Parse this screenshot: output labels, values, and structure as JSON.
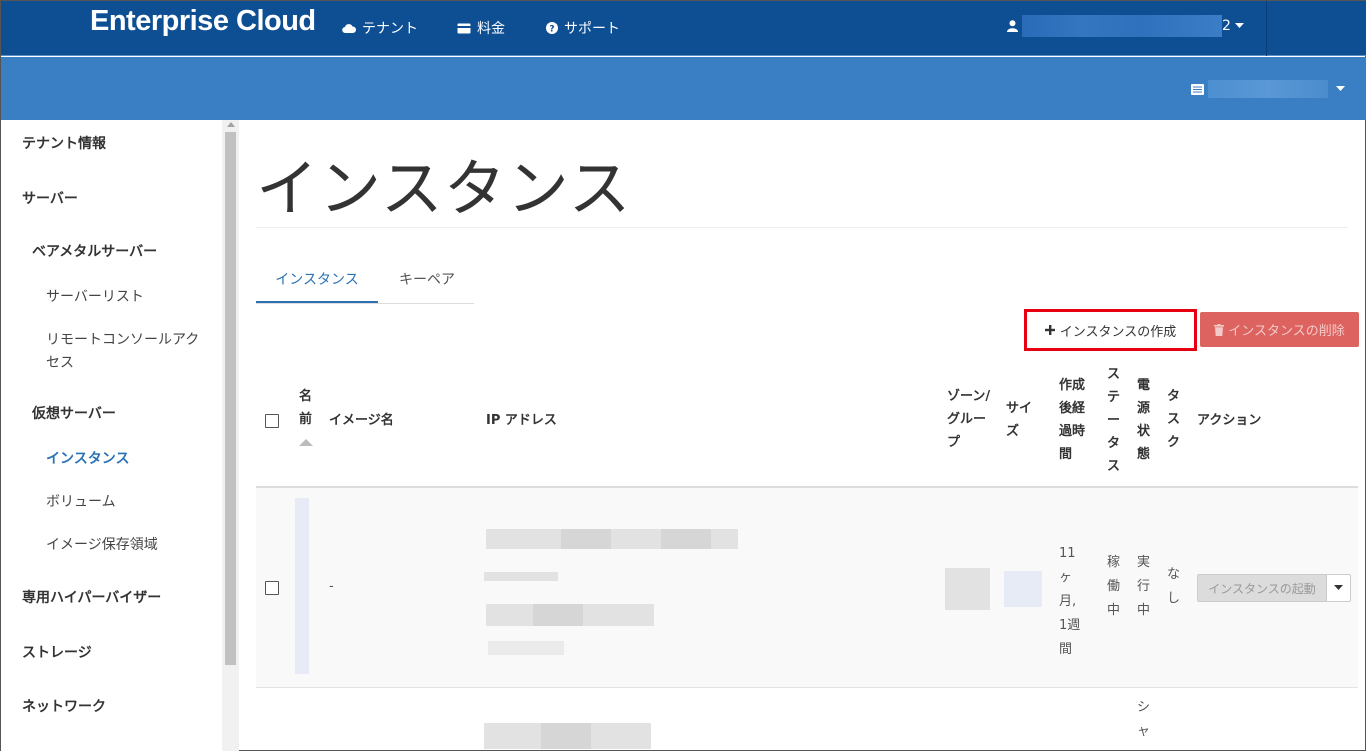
{
  "header": {
    "brand": "Enterprise Cloud",
    "nav": [
      {
        "label": "テナント",
        "icon": "cloud-icon"
      },
      {
        "label": "料金",
        "icon": "credit-card-icon"
      },
      {
        "label": "サポート",
        "icon": "question-circle-icon"
      }
    ],
    "user_icon": "user-icon",
    "user_visible_suffix": "2"
  },
  "sidebar": {
    "items": [
      {
        "label": "テナント情報",
        "level": 1
      },
      {
        "label": "サーバー",
        "level": 1
      },
      {
        "label": "ベアメタルサーバー",
        "level": 2
      },
      {
        "label": "サーバーリスト",
        "level": 3
      },
      {
        "label": "リモートコンソールアクセス",
        "level": 3
      },
      {
        "label": "仮想サーバー",
        "level": 2
      },
      {
        "label": "インスタンス",
        "level": 3,
        "active": true
      },
      {
        "label": "ボリューム",
        "level": 3
      },
      {
        "label": "イメージ保存領域",
        "level": 3
      },
      {
        "label": "専用ハイパーバイザー",
        "level": 1
      },
      {
        "label": "ストレージ",
        "level": 1
      },
      {
        "label": "ネットワーク",
        "level": 1
      }
    ]
  },
  "main": {
    "title": "インスタンス",
    "tabs": [
      {
        "label": "インスタンス",
        "active": true
      },
      {
        "label": "キーペア",
        "active": false
      }
    ],
    "actions": {
      "create_label": "インスタンスの作成",
      "delete_label": "インスタンスの削除"
    },
    "table": {
      "headers": {
        "name": "名前",
        "image": "イメージ名",
        "ip": "IP アドレス",
        "zone": "ゾーン/グループ",
        "size": "サイズ",
        "age": "作成後経過時間",
        "status": "ステータス",
        "power": "電源状態",
        "task": "タスク",
        "action": "アクション"
      },
      "rows": [
        {
          "image": "-",
          "age": "11ヶ月, 1週間",
          "status": "稼働中",
          "power": "実行中",
          "task": "なし",
          "action_label": "インスタンスの起動"
        },
        {
          "power_partial": "シャ"
        }
      ]
    }
  },
  "colors": {
    "topbar": "#0e4f94",
    "subbar": "#3a7ec4",
    "accent": "#2b72b5",
    "danger": "#d9534f",
    "highlight_box": "#e60012"
  }
}
